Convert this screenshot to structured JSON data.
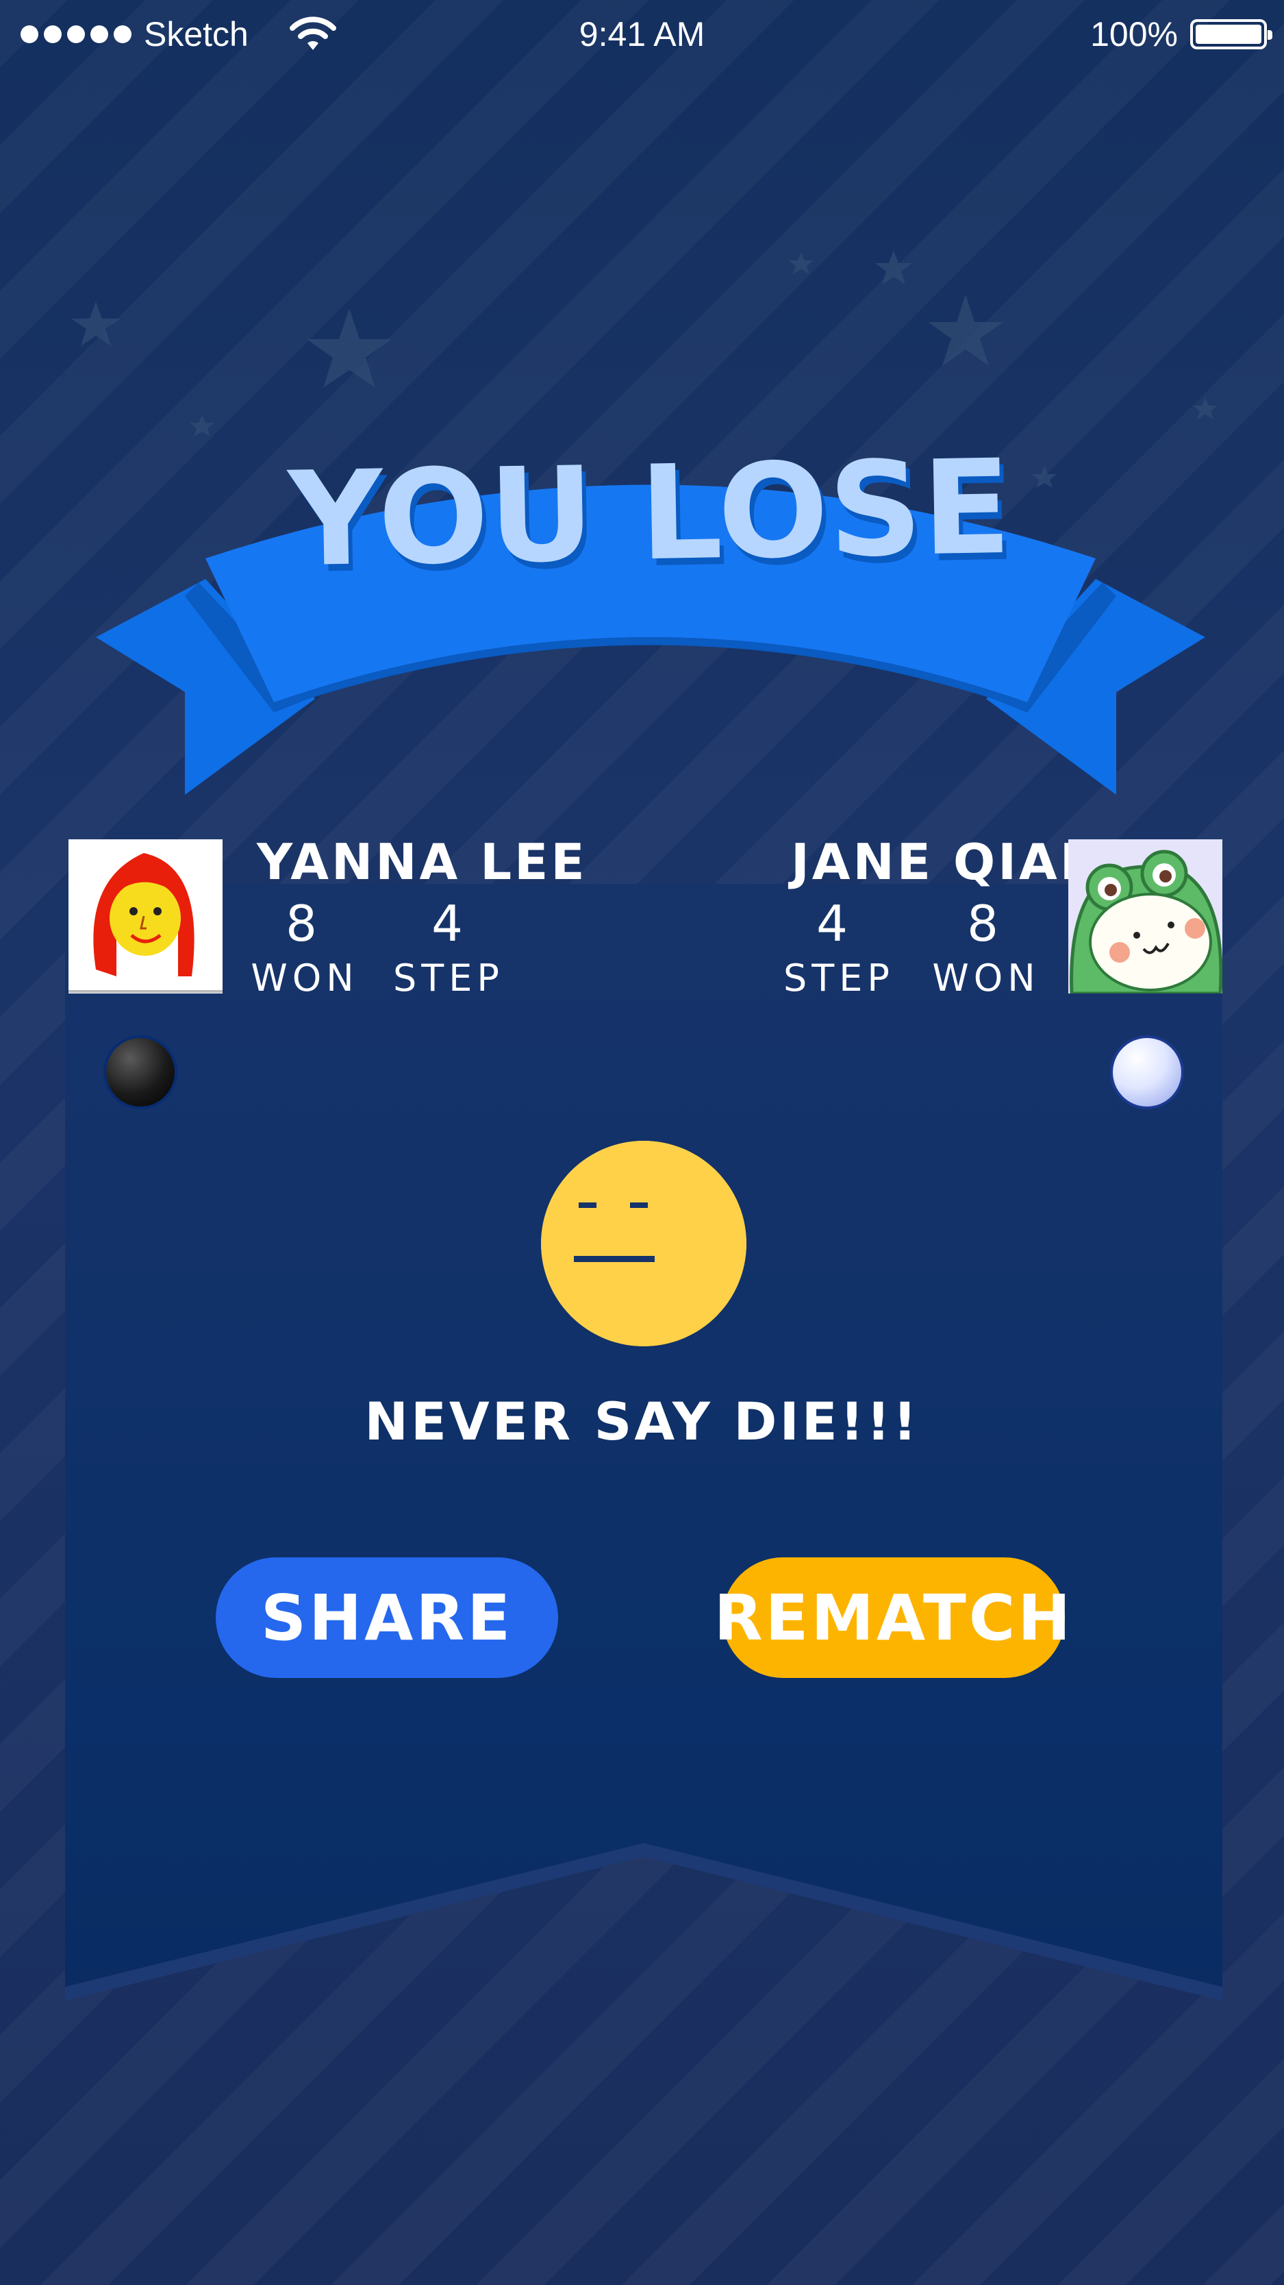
{
  "status_bar": {
    "carrier": "Sketch",
    "time": "9:41 AM",
    "battery": "100%"
  },
  "banner": {
    "title": "YOU LOSE",
    "color": "#1677f2",
    "title_color": "#b6d6ff"
  },
  "players": {
    "left": {
      "name": "YANNA LEE",
      "won_value": "8",
      "won_label": "WON",
      "step_value": "4",
      "step_label": "STEP",
      "piece": "black-stone-icon",
      "avatar": "red-hair-girl-avatar"
    },
    "right": {
      "name": "JANE QIAN",
      "won_value": "8",
      "won_label": "WON",
      "step_value": "4",
      "step_label": "STEP",
      "piece": "white-stone-icon",
      "avatar": "frog-hood-avatar"
    }
  },
  "result": {
    "emoji": "neutral-face-icon",
    "message": "NEVER SAY DIE!!!"
  },
  "buttons": {
    "share": "SHARE",
    "rematch": "REMATCH",
    "share_color": "#2568ee",
    "rematch_color": "#fdb400"
  }
}
